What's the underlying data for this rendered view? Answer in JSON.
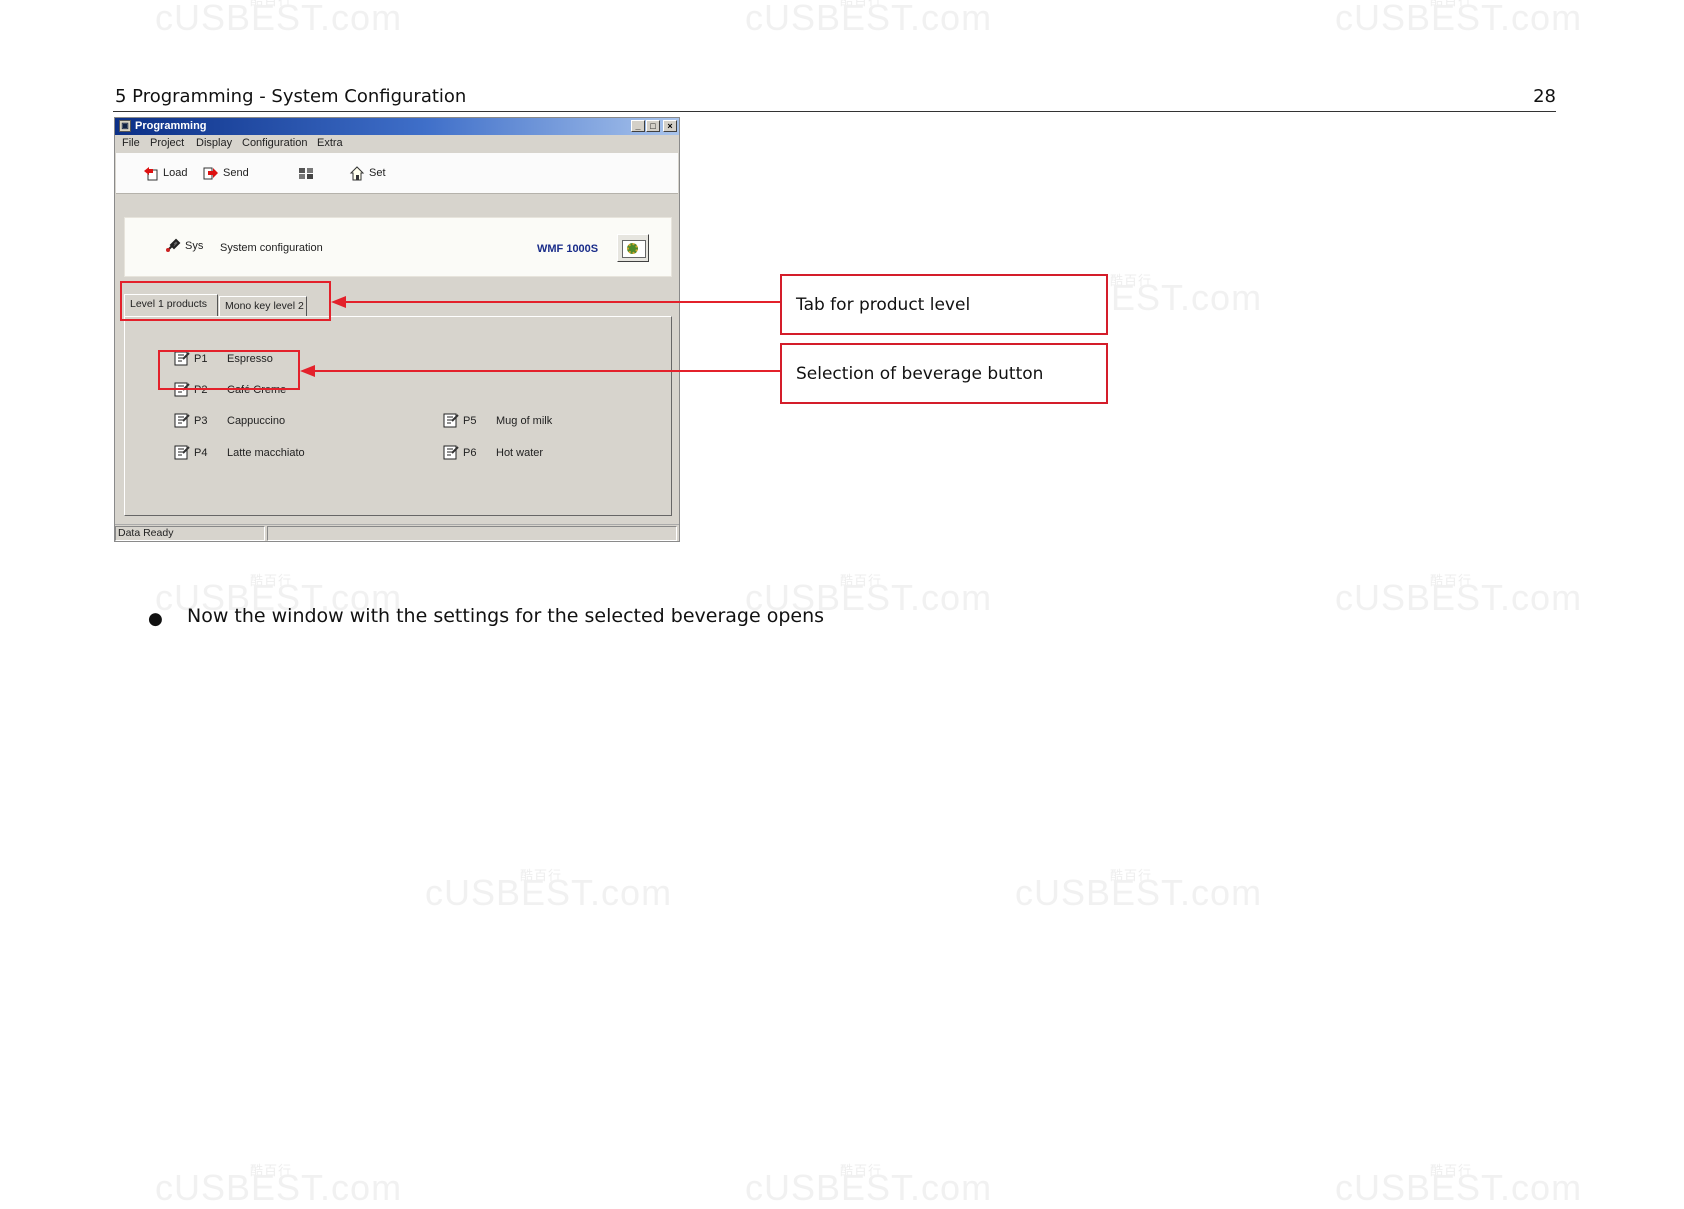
{
  "header": {
    "title": "5 Programming - System Configuration",
    "page_number": "28"
  },
  "watermark": {
    "text": "cUSBEST.com",
    "cn": "酷百行"
  },
  "window": {
    "title": "Programming",
    "menu": [
      "File",
      "Project",
      "Display",
      "Configuration",
      "Extra"
    ],
    "toolbar": {
      "load": "Load",
      "send": "Send",
      "set": "Set"
    },
    "system": {
      "short": "Sys",
      "description": "System configuration",
      "model": "WMF 1000S"
    },
    "tabs": [
      "Level 1 products",
      "Mono key level 2"
    ],
    "products": [
      {
        "code": "P1",
        "name": "Espresso"
      },
      {
        "code": "P2",
        "name": "Café Creme"
      },
      {
        "code": "P3",
        "name": "Cappuccino"
      },
      {
        "code": "P4",
        "name": "Latte macchiato"
      },
      {
        "code": "P5",
        "name": "Mug of milk"
      },
      {
        "code": "P6",
        "name": "Hot water"
      }
    ],
    "status": "Data Ready"
  },
  "callouts": {
    "tab": "Tab for product level",
    "beverage": "Selection of beverage button"
  },
  "bullet": "Now the window with the settings for the selected beverage opens",
  "colors": {
    "annotation_red": "#e3212b",
    "titlebar_blue": "#0b2f86",
    "window_grey": "#d7d4cd"
  }
}
